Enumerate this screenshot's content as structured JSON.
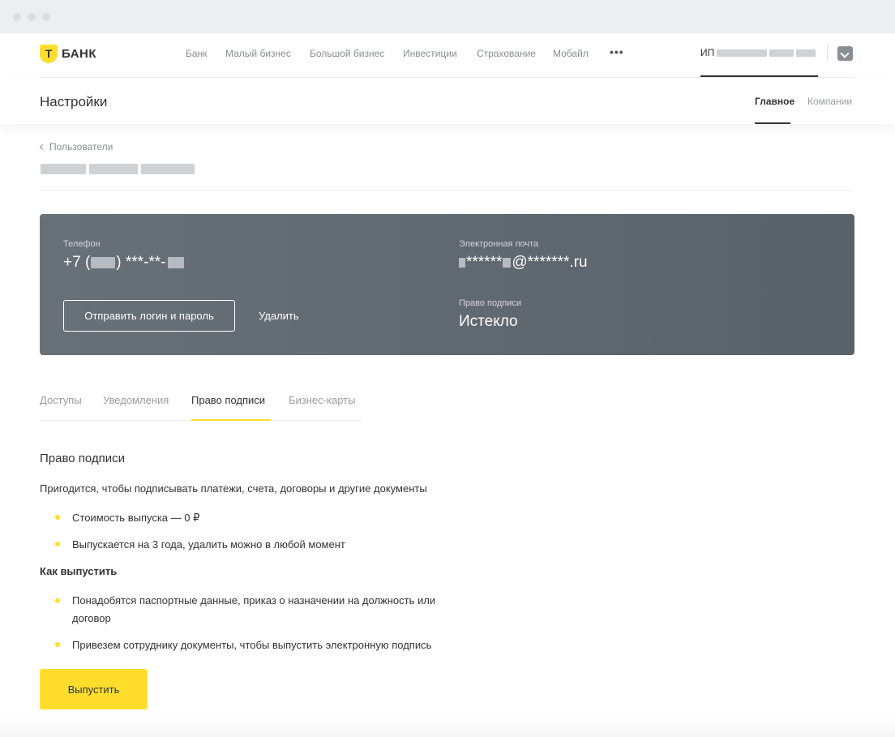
{
  "brand": {
    "logo_letter": "Т",
    "name": "БАНК",
    "accent_color": "#ffdd2d"
  },
  "nav": {
    "items": [
      "Банк",
      "Малый бизнес",
      "Большой бизнес",
      "Инвестиции",
      "Страхование",
      "Мобайл"
    ],
    "more_label": "•••",
    "account_prefix": "ИП"
  },
  "header": {
    "title": "Настройки",
    "tabs": [
      {
        "label": "Главное",
        "active": true
      },
      {
        "label": "Компании",
        "active": false
      }
    ]
  },
  "breadcrumb": {
    "back_label": "Пользователи"
  },
  "card": {
    "phone_label": "Телефон",
    "phone_prefix": "+7 (",
    "phone_mid": ") ***-**-",
    "email_label": "Электронная почта",
    "email_stars": "******",
    "email_domain": "@*******.ru",
    "signature_label": "Право подписи",
    "signature_value": "Истекло",
    "send_button": "Отправить логин и пароль",
    "delete_button": "Удалить"
  },
  "tabs": [
    {
      "label": "Доступы",
      "active": false
    },
    {
      "label": "Уведомления",
      "active": false
    },
    {
      "label": "Право подписи",
      "active": true
    },
    {
      "label": "Бизнес-карты",
      "active": false
    }
  ],
  "content": {
    "title": "Право подписи",
    "description": "Пригодится, чтобы подписывать платежи, счета, договоры и другие документы",
    "bullets": [
      "Стоимость выпуска — 0 ₽",
      "Выпускается на 3 года, удалить можно в любой момент"
    ],
    "how_title": "Как выпустить",
    "how_bullets": [
      "Понадобятся паспортные данные, приказ о назначении на должность или",
      "договор",
      "Привезем сотруднику документы, чтобы выпустить электронную подпись"
    ],
    "issue_button": "Выпустить"
  }
}
